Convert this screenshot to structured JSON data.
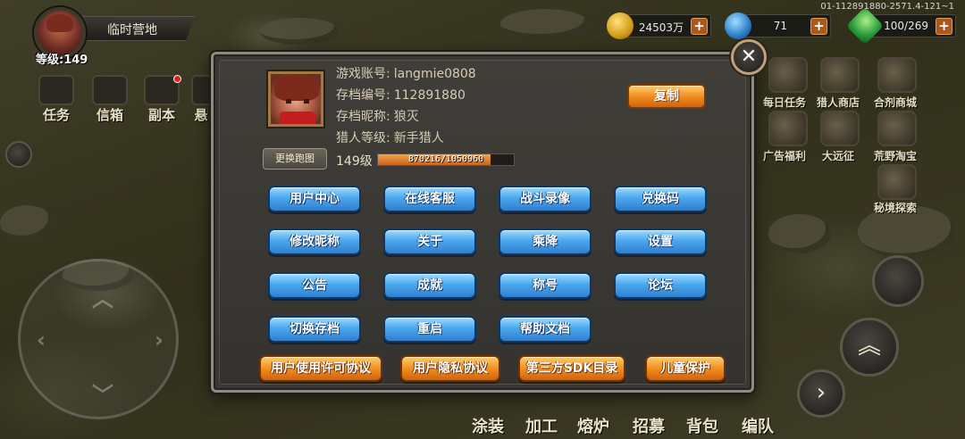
{
  "build_id": "01-112891880-2571.4-121~1",
  "player": {
    "location": "临时营地",
    "level_label": "等级:149"
  },
  "left_menu": [
    {
      "label": "任务",
      "icon": "scroll-icon"
    },
    {
      "label": "信箱",
      "icon": "mailbox-icon"
    },
    {
      "label": "副本",
      "icon": "dungeon-icon"
    },
    {
      "label": "悬",
      "icon": "bounty-icon"
    }
  ],
  "resources": {
    "gold": "24503万",
    "gems": "71",
    "stamina": "100/269"
  },
  "right_menu": [
    {
      "label": "每日任务",
      "icon": "daily-quest-icon"
    },
    {
      "label": "猎人商店",
      "icon": "hunter-shop-icon"
    },
    {
      "label": "合剂商城",
      "icon": "potion-mall-icon"
    },
    {
      "label": "广告福利",
      "icon": "ad-reward-icon"
    },
    {
      "label": "大远征",
      "icon": "expedition-icon"
    },
    {
      "label": "荒野淘宝",
      "icon": "wild-treasure-icon"
    },
    {
      "label": "秘境探索",
      "icon": "secret-realm-icon"
    }
  ],
  "bottom_menu": [
    "涂装",
    "加工",
    "熔炉",
    "招募",
    "背包",
    "编队"
  ],
  "dialog": {
    "rows": [
      {
        "label": "游戏账号:",
        "value": "langmie0808"
      },
      {
        "label": "存档编号:",
        "value": "112891880"
      },
      {
        "label": "存档昵称:",
        "value": "狼灭"
      },
      {
        "label": "猎人等级:",
        "value": "新手猎人"
      }
    ],
    "level": "149级",
    "exp_text": "870216/1050960",
    "exp_fraction": 0.828,
    "change_sprite": "更换跑图",
    "copy": "复制",
    "buttons": [
      "用户中心",
      "在线客服",
      "战斗录像",
      "兑换码",
      "修改昵称",
      "关于",
      "乘降",
      "设置",
      "公告",
      "成就",
      "称号",
      "论坛",
      "切换存档",
      "重启",
      "帮助文档"
    ],
    "legal": [
      "用户使用许可协议",
      "用户隐私协议",
      "第三方SDK目录",
      "儿童保护"
    ],
    "close": "✕"
  },
  "colors": {
    "blue_button": "#4aa8ee",
    "orange_button": "#f08a1c",
    "dialog_bg": "#3a3834"
  }
}
